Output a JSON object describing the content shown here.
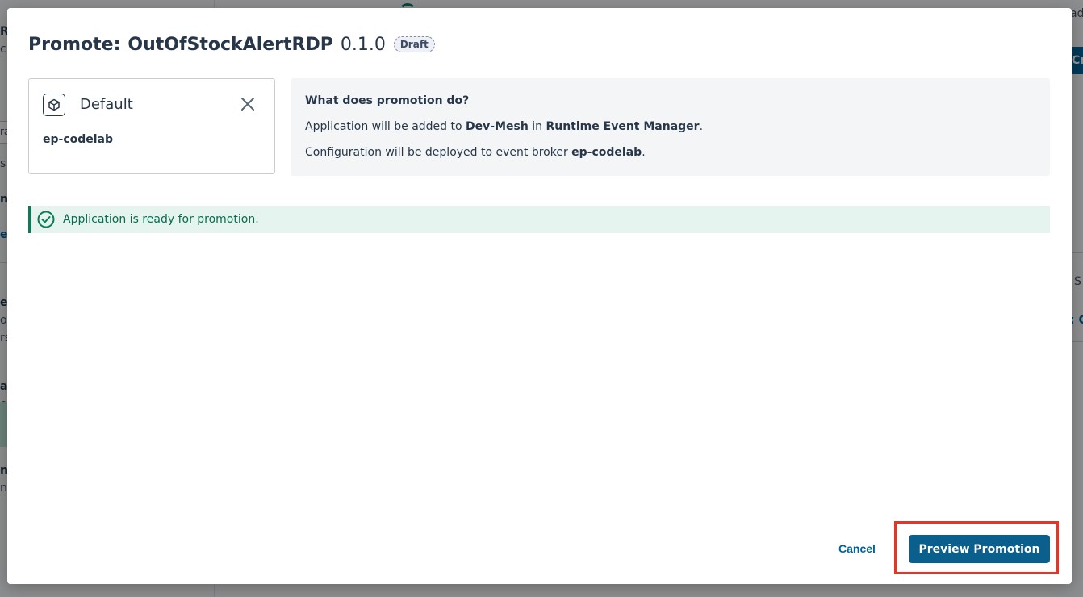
{
  "background": {
    "fragments": {
      "left_top_1": "R",
      "left_top_2": "c",
      "left_tab": "ra",
      "left_s": "s",
      "left_na": "na",
      "left_e": "e",
      "left_ev": "ev",
      "left_or": "or",
      "left_rs": "rs",
      "left_at": "at",
      "left_er": "er",
      "left_n": "n",
      "left_ne": "ne",
      "right_ad": "ad",
      "right_s": "S",
      "right_c": ": C",
      "right_btn": "Cr"
    }
  },
  "modal": {
    "title_prefix": "Promote:",
    "title_name": "OutOfStockAlertRDP",
    "title_version": "0.1.0",
    "status_badge": "Draft",
    "environment": {
      "name": "Default",
      "broker": "ep-codelab",
      "icon": "cube-icon",
      "remove_icon": "close-icon"
    },
    "info": {
      "heading": "What does promotion do?",
      "line1_prefix": "Application will be added to ",
      "line1_mesh": "Dev-Mesh",
      "line1_mid": " in ",
      "line1_product": "Runtime Event Manager",
      "line1_end": ".",
      "line2_prefix": "Configuration will be deployed to event broker ",
      "line2_broker": "ep-codelab",
      "line2_end": "."
    },
    "status_message": "Application is ready for promotion.",
    "status_icon": "check-circle-icon",
    "buttons": {
      "cancel": "Cancel",
      "preview": "Preview Promotion"
    },
    "colors": {
      "primary": "#0b5f8c",
      "link": "#00629b",
      "success": "#0a7c5a",
      "highlight": "#ea3323"
    }
  }
}
